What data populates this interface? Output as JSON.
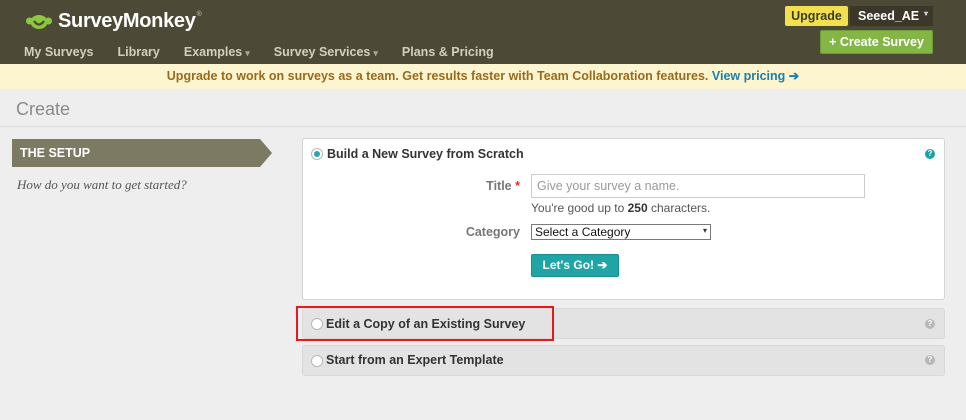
{
  "header": {
    "logo_text": "SurveyMonkey",
    "logo_reg": "®",
    "nav": [
      {
        "label": "My Surveys",
        "caret": ""
      },
      {
        "label": "Library",
        "caret": ""
      },
      {
        "label": "Examples",
        "caret": "▾"
      },
      {
        "label": "Survey Services",
        "caret": "▾"
      },
      {
        "label": "Plans & Pricing",
        "caret": ""
      }
    ],
    "upgrade_label": "Upgrade",
    "username": "Seeed_AE",
    "user_caret": "▾",
    "create_label": "+ Create Survey"
  },
  "banner": {
    "text": "Upgrade to work on surveys as a team. Get results faster with Team Collaboration features.",
    "link": "View pricing ➔"
  },
  "page_title": "Create",
  "setup": {
    "tab_label": "THE SETUP",
    "description": "How do you want to get started?"
  },
  "options": {
    "scratch": {
      "label": "Build a New Survey from Scratch",
      "help": "?",
      "title_label": "Title",
      "required_mark": "*",
      "title_placeholder": "Give your survey a name.",
      "hint_prefix": "You're good up to",
      "hint_count": "250",
      "hint_suffix": "characters.",
      "category_label": "Category",
      "category_value": "Select a Category",
      "category_caret": "▾",
      "go_label": "Let's Go! ➔"
    },
    "copy": {
      "label": "Edit a Copy of an Existing Survey",
      "help": "?"
    },
    "template": {
      "label": "Start from an Expert Template",
      "help": "?"
    }
  },
  "colors": {
    "header_bg": "#4d4937",
    "accent_teal": "#1fa5a6",
    "create_green": "#83b644",
    "upgrade_yellow": "#f2e14c",
    "highlight_red": "#e31b1b"
  }
}
